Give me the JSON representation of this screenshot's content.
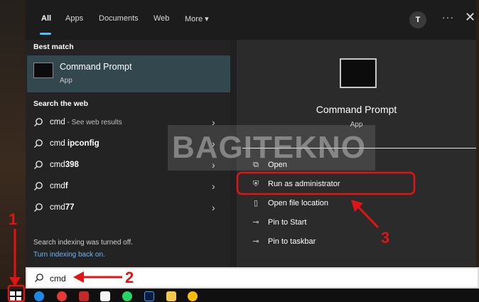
{
  "tabs": [
    {
      "label": "All",
      "active": true
    },
    {
      "label": "Apps"
    },
    {
      "label": "Documents"
    },
    {
      "label": "Web"
    },
    {
      "label": "More ▾"
    }
  ],
  "avatar_initial": "T",
  "more_glyph": "···",
  "close_glyph": "✕",
  "best_match": {
    "heading": "Best match",
    "title": "Command Prompt",
    "subtitle": "App"
  },
  "web": {
    "heading": "Search the web",
    "items": [
      {
        "query": "cmd",
        "suffix": " - See web results",
        "bold": ""
      },
      {
        "query": "cmd ",
        "suffix": "",
        "bold": "ipconfig"
      },
      {
        "query": "cmd",
        "suffix": "",
        "bold": "398"
      },
      {
        "query": "cmd",
        "suffix": "",
        "bold": "f"
      },
      {
        "query": "cmd",
        "suffix": "",
        "bold": "77"
      }
    ]
  },
  "indexing": {
    "note": "Search indexing was turned off.",
    "link": "Turn indexing back on."
  },
  "detail": {
    "title": "Command Prompt",
    "subtitle": "App",
    "actions": [
      {
        "icon": "open-icon",
        "label": "Open"
      },
      {
        "icon": "shield-run-icon",
        "label": "Run as administrator"
      },
      {
        "icon": "folder-location-icon",
        "label": "Open file location"
      },
      {
        "icon": "pin-icon",
        "label": "Pin to Start"
      },
      {
        "icon": "pin-icon",
        "label": "Pin to taskbar"
      }
    ]
  },
  "watermark": "BAGITEKNO",
  "search_box": {
    "value": "cmd"
  },
  "annotations": {
    "one": "1",
    "two": "2",
    "three": "3"
  },
  "colors": {
    "accent": "#4cc2ff",
    "highlight": "#e01414",
    "selected": "#33474f"
  }
}
